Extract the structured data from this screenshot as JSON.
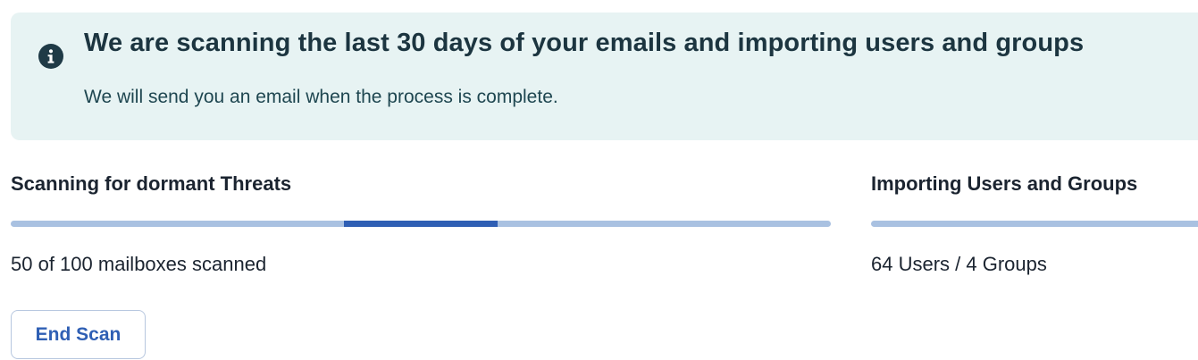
{
  "banner": {
    "icon": "info-icon",
    "title": "We are scanning the last 30 days of your emails and importing users and groups",
    "subtitle": "We will send you an email when the process is complete.",
    "background_color": "#e7f3f3"
  },
  "scan_section": {
    "title": "Scanning for dormant Threats",
    "progress_text": "50 of 100 mailboxes scanned",
    "progress": {
      "indeterminate": true,
      "track_color": "#a9c1e1",
      "fill_color": "#2f5fb4"
    },
    "end_button_label": "End Scan"
  },
  "import_section": {
    "title": "Importing Users and Groups",
    "progress_text": "64 Users / 4 Groups"
  },
  "colors": {
    "accent": "#2f5fb4",
    "text": "#1b2430"
  }
}
